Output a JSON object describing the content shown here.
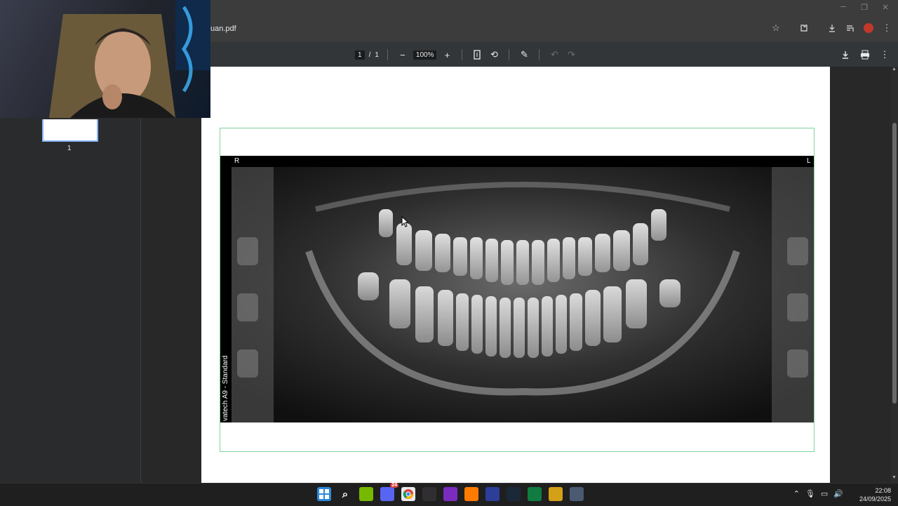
{
  "browser": {
    "url_fragment": "uan.pdf",
    "window_controls": [
      "minimize",
      "restore",
      "close"
    ],
    "icons": [
      "star-icon",
      "extensions-icon",
      "download-icon",
      "media-icon",
      "profile-avatar",
      "menu-icon"
    ]
  },
  "pdf_toolbar": {
    "current_page": "1",
    "page_separator": "/",
    "total_pages": "1",
    "zoom": "100%"
  },
  "sidebar": {
    "thumbnail_label": "1"
  },
  "document": {
    "marker_right": "R",
    "marker_left": "L",
    "device_label": "vatech A9 - Standard"
  },
  "taskbar": {
    "apps": [
      {
        "name": "start",
        "color": "#2b88d8"
      },
      {
        "name": "search",
        "color": "#1f1f1f"
      },
      {
        "name": "nvidia",
        "color": "#76b900"
      },
      {
        "name": "discord",
        "color": "#5865f2"
      },
      {
        "name": "chrome",
        "color": "#e8eaed"
      },
      {
        "name": "obs",
        "color": "#302e31"
      },
      {
        "name": "next",
        "color": "#7b2cbf"
      },
      {
        "name": "adobe-illustrator",
        "color": "#ff7a00"
      },
      {
        "name": "fan-app",
        "color": "#2c3e9a"
      },
      {
        "name": "steam",
        "color": "#1b2838"
      },
      {
        "name": "excel",
        "color": "#107c41"
      },
      {
        "name": "notes",
        "color": "#d4a017"
      },
      {
        "name": "settings",
        "color": "#4a5a70"
      }
    ],
    "discord_badge": "24",
    "time": "22:08",
    "date": "24/09/2025"
  }
}
